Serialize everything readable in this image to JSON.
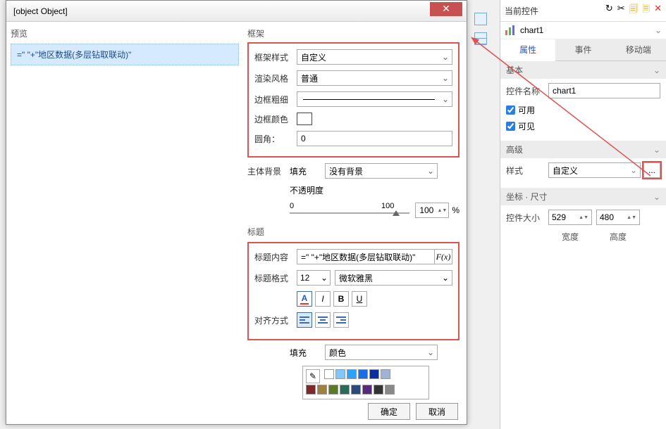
{
  "dialog": {
    "title": {
      "content_label": "标题内容",
      "content_value": "=\"  \"+\"地区数据(多层钻取联动)\"",
      "fx": "F(x)",
      "format_label": "标题格式",
      "size": "12",
      "font": "微软雅黑",
      "align_label": "对齐方式"
    },
    "preview_label": "预览",
    "preview_text": "=\"  \"+\"地区数据(多层钻取联动)\"",
    "frame_label": "框架",
    "frame": {
      "style_label": "框架样式",
      "style_value": "自定义",
      "render_label": "渲染风格",
      "render_value": "普通",
      "border_label": "边框粗细",
      "color_label": "边框颜色",
      "radius_label": "圆角：",
      "radius_value": "0"
    },
    "body_label": "主体背景",
    "fill_label": "填充",
    "fill_value": "没有背景",
    "opacity_label": "不透明度",
    "opacity_min": "0",
    "opacity_max": "100",
    "opacity_value": "100",
    "opacity_unit": "%",
    "title_section": "标题",
    "fill2_label": "填充",
    "fill2_value": "颜色",
    "palette_row1": [
      "#ffffff",
      "#7fc8ff",
      "#2aa3ff",
      "#1a6fe6",
      "#0b2f9e",
      "#9fb3d9"
    ],
    "palette_row2": [
      "#7a2a2a",
      "#a08040",
      "#5a7a2a",
      "#2a6a5a",
      "#2a4a7a",
      "#5a2a7a",
      "#333333",
      "#888888"
    ],
    "ok": "确定",
    "cancel": "取消"
  },
  "side": {
    "title": "当前控件",
    "control_name": "chart1",
    "tabs": {
      "prop": "属性",
      "event": "事件",
      "mobile": "移动端"
    },
    "basic": "基本",
    "name_label": "控件名称",
    "name_value": "chart1",
    "usable": "可用",
    "visible": "可见",
    "advanced": "高级",
    "style_label": "样式",
    "style_value": "自定义",
    "ellipsis": "...",
    "coord": "坐标 · 尺寸",
    "size_label": "控件大小",
    "width_value": "529",
    "height_value": "480",
    "width_cap": "宽度",
    "height_cap": "高度"
  }
}
